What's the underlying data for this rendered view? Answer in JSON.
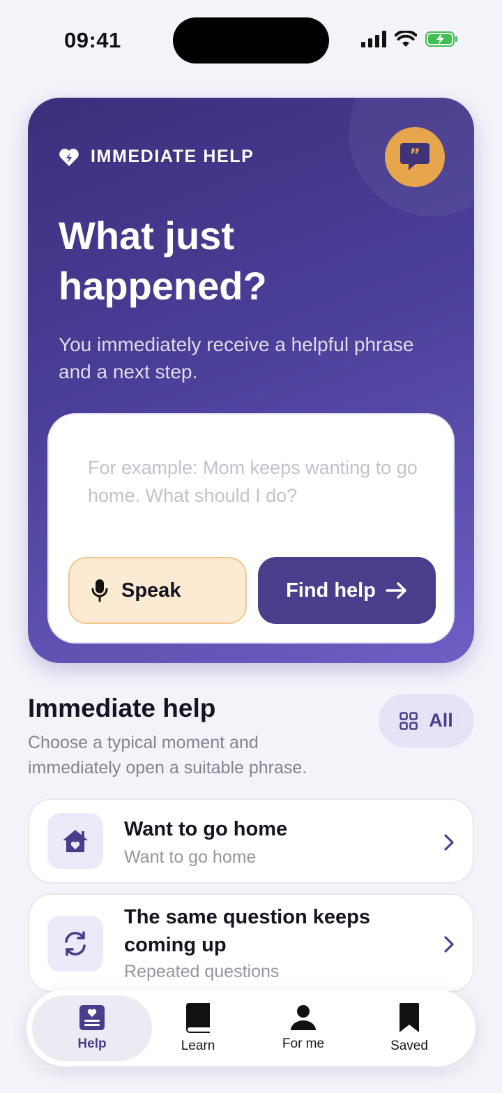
{
  "status_bar": {
    "time": "09:41"
  },
  "hero": {
    "eyebrow": "IMMEDIATE HELP",
    "title": "What just happened?",
    "subtitle": "You immediately receive a helpful phrase and a next step.",
    "input_placeholder": "For example: Mom keeps wanting to go home. What should I do?",
    "speak_label": "Speak",
    "find_help_label": "Find help"
  },
  "section": {
    "title": "Immediate help",
    "description": "Choose a typical moment and immediately open a suitable phrase.",
    "all_label": "All"
  },
  "help_items": [
    {
      "title": "Want to go home",
      "subtitle": "Want to go home",
      "icon": "home-icon"
    },
    {
      "title": "The same question keeps coming up",
      "subtitle": "Repeated questions",
      "icon": "repeat-icon"
    }
  ],
  "tabs": [
    {
      "label": "Help",
      "icon": "help-tab-icon",
      "active": true
    },
    {
      "label": "Learn",
      "icon": "book-icon",
      "active": false
    },
    {
      "label": "For me",
      "icon": "person-icon",
      "active": false
    },
    {
      "label": "Saved",
      "icon": "bookmark-icon",
      "active": false
    }
  ],
  "colors": {
    "accent": "#483e8c",
    "hero_gradient_start": "#3b2f7c",
    "hero_gradient_end": "#6d5fc4",
    "orange": "#e7a54c",
    "speak_bg": "#fcebd2",
    "background": "#f4f3fa"
  }
}
